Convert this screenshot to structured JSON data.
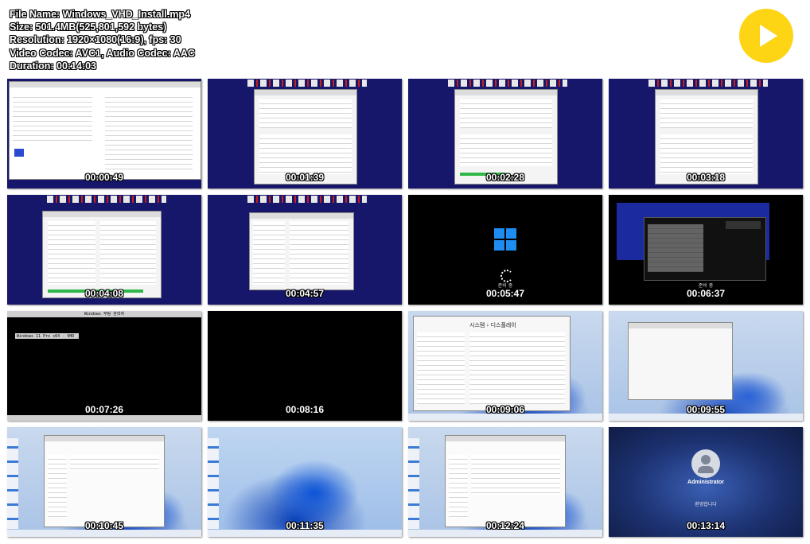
{
  "file_info": {
    "file_name": "File Name: Windows_VHD_Install.mp4",
    "size": "Size: 501.4MB(525,801,592 bytes)",
    "resolution": "Resolution: 1920×1080(16:9), fps: 30",
    "codec": "Video Codec: AVC1, Audio Codec: AAC",
    "duration": "Duration: 00:14:03"
  },
  "play_icon": "play-icon",
  "accent_color": "#fdd514",
  "thumbnails": [
    {
      "time": "00:00:49"
    },
    {
      "time": "00:01:39"
    },
    {
      "time": "00:02:28"
    },
    {
      "time": "00:03:18"
    },
    {
      "time": "00:04:08"
    },
    {
      "time": "00:04:57"
    },
    {
      "time": "00:05:47"
    },
    {
      "time": "00:06:37"
    },
    {
      "time": "00:07:26"
    },
    {
      "time": "00:08:16"
    },
    {
      "time": "00:09:06"
    },
    {
      "time": "00:09:55"
    },
    {
      "time": "00:10:45"
    },
    {
      "time": "00:11:35"
    },
    {
      "time": "00:12:24"
    },
    {
      "time": "00:13:14"
    }
  ],
  "screens": {
    "boot_status": "준비 중",
    "settings_title": "시스템 › 디스플레이",
    "boot_manager_title": "Windows 부팅 관리자",
    "boot_entry": "Windows 11 Pro x64 - VHD",
    "lock_user": "Administrator",
    "lock_status": "환영합니다"
  }
}
